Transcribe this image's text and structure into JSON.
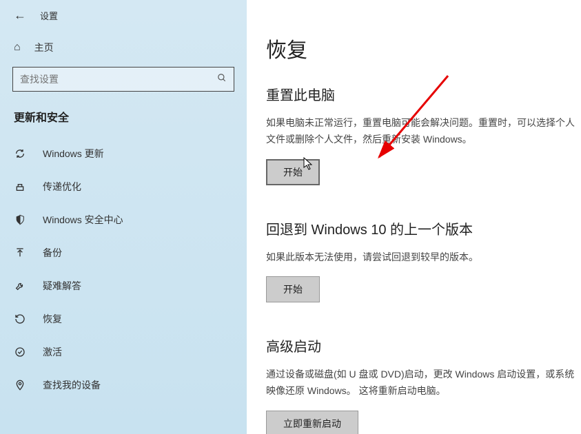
{
  "header": {
    "app_title": "设置"
  },
  "home": {
    "label": "主页"
  },
  "search": {
    "placeholder": "查找设置"
  },
  "category": {
    "title": "更新和安全"
  },
  "nav": {
    "items": [
      {
        "label": "Windows 更新"
      },
      {
        "label": "传递优化"
      },
      {
        "label": "Windows 安全中心"
      },
      {
        "label": "备份"
      },
      {
        "label": "疑难解答"
      },
      {
        "label": "恢复"
      },
      {
        "label": "激活"
      },
      {
        "label": "查找我的设备"
      }
    ]
  },
  "page": {
    "title": "恢复"
  },
  "sections": {
    "reset": {
      "title": "重置此电脑",
      "desc": "如果电脑未正常运行，重置电脑可能会解决问题。重置时，可以选择个人文件或删除个人文件，然后重新安装 Windows。",
      "button": "开始"
    },
    "rollback": {
      "title": "回退到 Windows 10 的上一个版本",
      "desc": "如果此版本无法使用，请尝试回退到较早的版本。",
      "button": "开始"
    },
    "advanced": {
      "title": "高级启动",
      "desc": "通过设备或磁盘(如 U 盘或 DVD)启动，更改 Windows 启动设置，或系统映像还原 Windows。 这将重新启动电脑。",
      "button": "立即重新启动"
    }
  }
}
